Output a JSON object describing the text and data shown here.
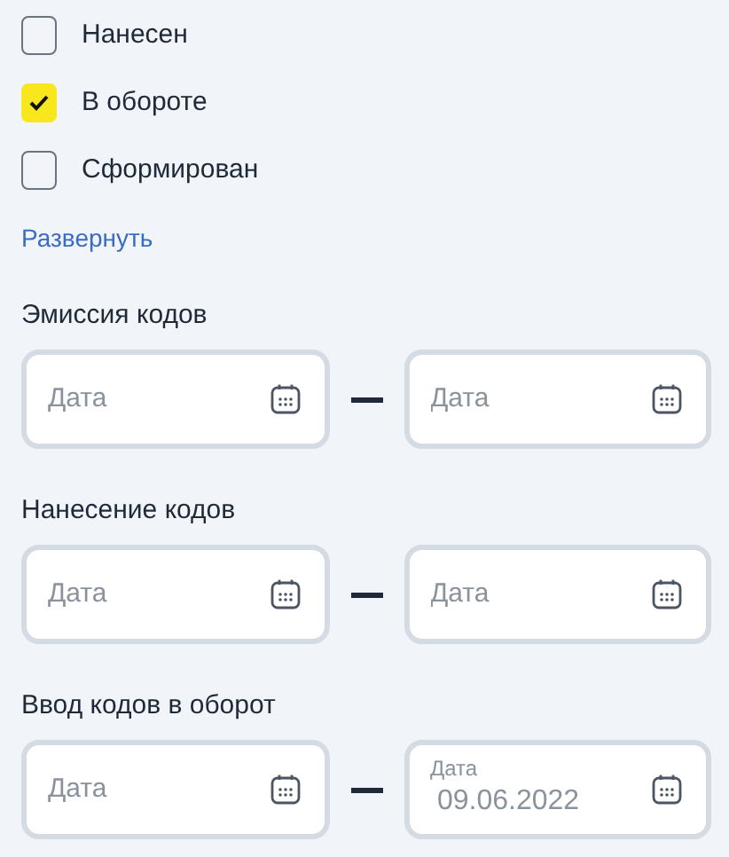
{
  "statuses": [
    {
      "label": "Нанесен",
      "checked": false
    },
    {
      "label": "В обороте",
      "checked": true
    },
    {
      "label": "Сформирован",
      "checked": false
    }
  ],
  "expand_link": "Развернуть",
  "date_ranges": [
    {
      "title": "Эмиссия кодов",
      "from": {
        "placeholder": "Дата"
      },
      "to": {
        "placeholder": "Дата"
      }
    },
    {
      "title": "Нанесение кодов",
      "from": {
        "placeholder": "Дата"
      },
      "to": {
        "placeholder": "Дата"
      }
    },
    {
      "title": "Ввод кодов в оборот",
      "from": {
        "placeholder": "Дата"
      },
      "to": {
        "label": "Дата",
        "value": "09.06.2022"
      }
    }
  ]
}
